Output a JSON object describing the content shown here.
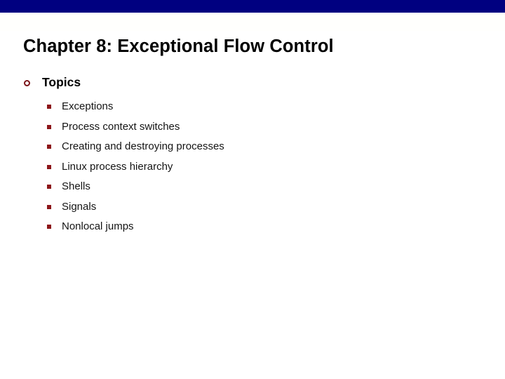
{
  "slide": {
    "title": "Chapter 8: Exceptional Flow Control",
    "theme": {
      "banner_color": "#000080",
      "background_color": "#FFFFFF",
      "title_color": "#000000",
      "level1_bullet_color": "#7B1418",
      "level2_bullet_color": "#8C1519",
      "body_text_color": "#141414"
    },
    "outline": {
      "heading": {
        "label": "Topics",
        "bullet_icon": "hollow-circle-bullet-icon"
      },
      "items": [
        {
          "label": "Exceptions",
          "bullet_icon": "square-bullet-icon"
        },
        {
          "label": "Process context switches",
          "bullet_icon": "square-bullet-icon"
        },
        {
          "label": "Creating and destroying processes",
          "bullet_icon": "square-bullet-icon"
        },
        {
          "label": "Linux process hierarchy",
          "bullet_icon": "square-bullet-icon"
        },
        {
          "label": "Shells",
          "bullet_icon": "square-bullet-icon"
        },
        {
          "label": "Signals",
          "bullet_icon": "square-bullet-icon"
        },
        {
          "label": "Nonlocal jumps",
          "bullet_icon": "square-bullet-icon"
        }
      ]
    }
  }
}
